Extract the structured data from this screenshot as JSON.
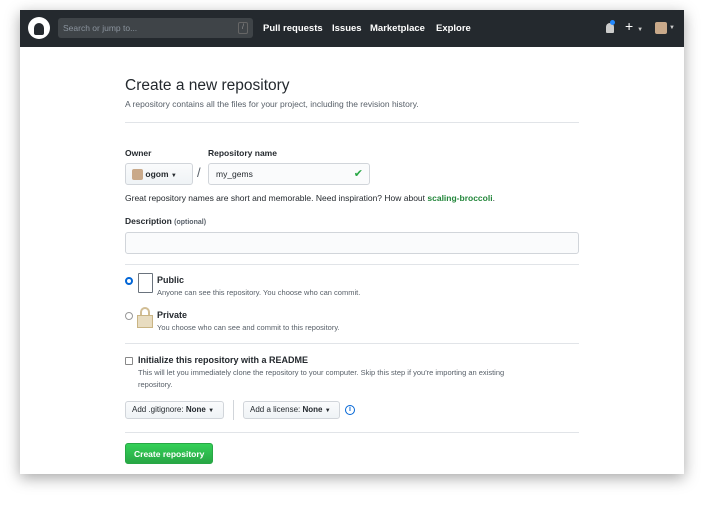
{
  "header": {
    "search_placeholder": "Search or jump to...",
    "search_shortcut": "/",
    "nav": [
      "Pull requests",
      "Issues",
      "Marketplace",
      "Explore"
    ],
    "new_label": "+"
  },
  "page": {
    "title": "Create a new repository",
    "subtitle": "A repository contains all the files for your project, including the revision history."
  },
  "owner": {
    "label": "Owner",
    "value": "ogom"
  },
  "repo_name": {
    "label": "Repository name",
    "value": "my_gems",
    "separator": "/"
  },
  "hint": {
    "text": "Great repository names are short and memorable. Need inspiration? How about ",
    "suggestion": "scaling-broccoli",
    "end": "."
  },
  "description": {
    "label": "Description",
    "optional": "(optional)",
    "value": ""
  },
  "visibility": [
    {
      "title": "Public",
      "desc": "Anyone can see this repository. You choose who can commit.",
      "selected": true
    },
    {
      "title": "Private",
      "desc": "You choose who can see and commit to this repository.",
      "selected": false
    }
  ],
  "readme": {
    "label": "Initialize this repository with a README",
    "desc1": "This will let you immediately clone the repository to your computer. Skip this step if you're importing an existing",
    "desc2": "repository.",
    "checked": false
  },
  "gitignore": {
    "label": "Add .gitignore:",
    "value": "None"
  },
  "license": {
    "label": "Add a license:",
    "value": "None"
  },
  "submit": "Create repository"
}
